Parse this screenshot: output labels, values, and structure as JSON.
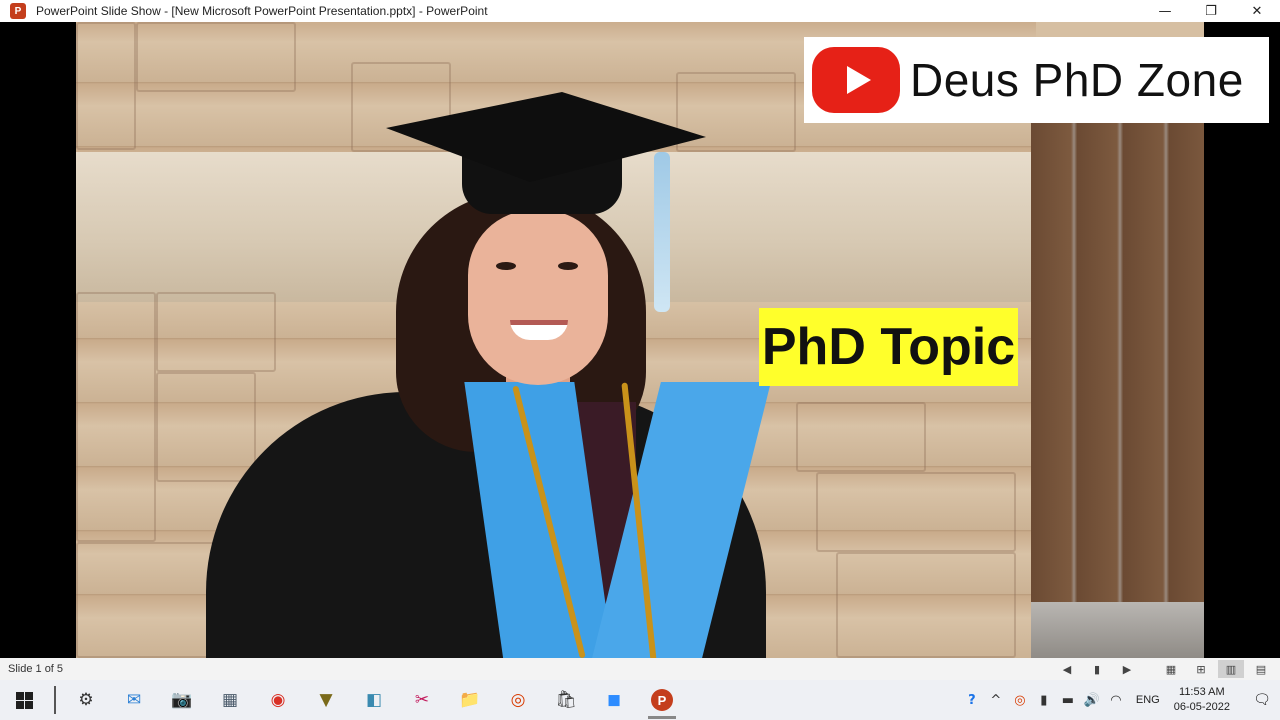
{
  "window": {
    "title": "PowerPoint Slide Show - [New Microsoft PowerPoint Presentation.pptx] - PowerPoint",
    "app_icon_letter": "P",
    "minimize": "—",
    "restore": "❐",
    "close": "✕"
  },
  "slide": {
    "brand_text": "Deus PhD Zone",
    "topic_text": "PhD Topic",
    "colors": {
      "topic_bg": "#ffff2b",
      "yt_red": "#e62117"
    }
  },
  "statusbar": {
    "slide_count": "Slide 1 of 5",
    "controls": [
      "◀",
      "▮",
      "▶",
      "▦",
      "⊞",
      "▥",
      "▤"
    ]
  },
  "taskbar": {
    "apps": [
      {
        "name": "settings-icon",
        "glyph": "⚙"
      },
      {
        "name": "mail-app-icon",
        "glyph": "✉"
      },
      {
        "name": "camera-icon",
        "glyph": "📷"
      },
      {
        "name": "calculator-icon",
        "glyph": "▦"
      },
      {
        "name": "chrome-icon",
        "glyph": "◉"
      },
      {
        "name": "app-9-icon",
        "glyph": "▼"
      },
      {
        "name": "pen-app-icon",
        "glyph": "◧"
      },
      {
        "name": "snipping-tool-icon",
        "glyph": "✂"
      },
      {
        "name": "file-explorer-icon",
        "glyph": "📁"
      },
      {
        "name": "office-app-icon",
        "glyph": "◎"
      },
      {
        "name": "store-icon",
        "glyph": "🛍"
      },
      {
        "name": "zoom-icon",
        "glyph": "◼"
      },
      {
        "name": "powerpoint-icon",
        "glyph": "P"
      }
    ],
    "tray": {
      "help": "?",
      "chevron": "^",
      "lang": "ENG",
      "time": "11:53 AM",
      "date": "06-05-2022",
      "notification": "🗨"
    }
  }
}
